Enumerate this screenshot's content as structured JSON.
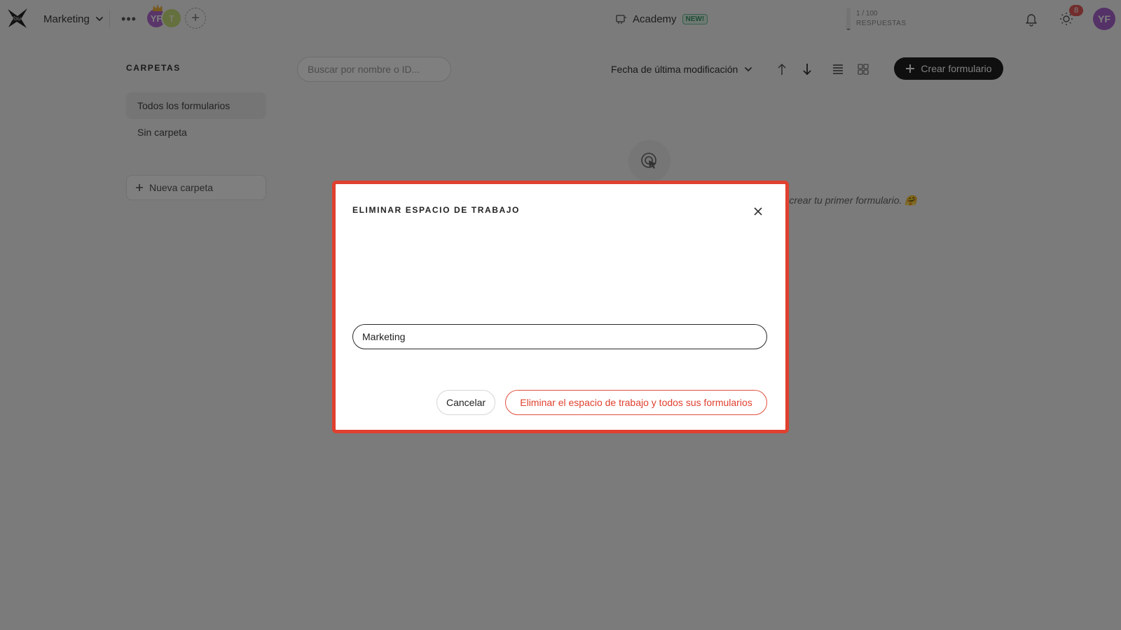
{
  "topbar": {
    "workspace_name": "Marketing",
    "avatars": [
      {
        "initials": "YF",
        "color": "#b56bd3"
      },
      {
        "initials": "T",
        "color": "#c8e07a"
      }
    ],
    "add_member_glyph": "+",
    "more_glyph": "•••",
    "academy_label": "Academy",
    "academy_badge": "NEW!",
    "quota": {
      "count": "1 / 100",
      "label": "RESPUESTAS",
      "used": 1,
      "total": 100
    },
    "notification_count": "8",
    "user_initials": "YF",
    "user_color": "#a962cf"
  },
  "sidebar": {
    "title": "CARPETAS",
    "items": [
      {
        "label": "Todos los formularios",
        "active": true
      },
      {
        "label": "Sin carpeta",
        "active": false
      }
    ],
    "new_folder_label": "Nueva carpeta"
  },
  "toolbar": {
    "search_placeholder": "Buscar por nombre o ID...",
    "sort_label": "Fecha de última modificación",
    "create_label": "Crear formulario"
  },
  "empty_state": {
    "text": "ra crear tu primer formulario. 🤗"
  },
  "modal": {
    "title": "ELIMINAR ESPACIO DE TRABAJO",
    "input_value": "Marketing",
    "cancel_label": "Cancelar",
    "delete_label": "Eliminar el espacio de trabajo y todos sus formularios"
  },
  "colors": {
    "accent_danger": "#e0402f",
    "primary_dark": "#1f1f1f",
    "overlay": "rgba(0,0,0,0.5)"
  },
  "icons": [
    "logo-icon",
    "chevron-down-icon",
    "crown-icon",
    "graduation-cap-icon",
    "bell-icon",
    "sun-icon",
    "plus-icon",
    "sort-ascending-icon",
    "sort-descending-icon",
    "list-view-icon",
    "grid-view-icon",
    "pointer-click-icon",
    "close-icon"
  ]
}
